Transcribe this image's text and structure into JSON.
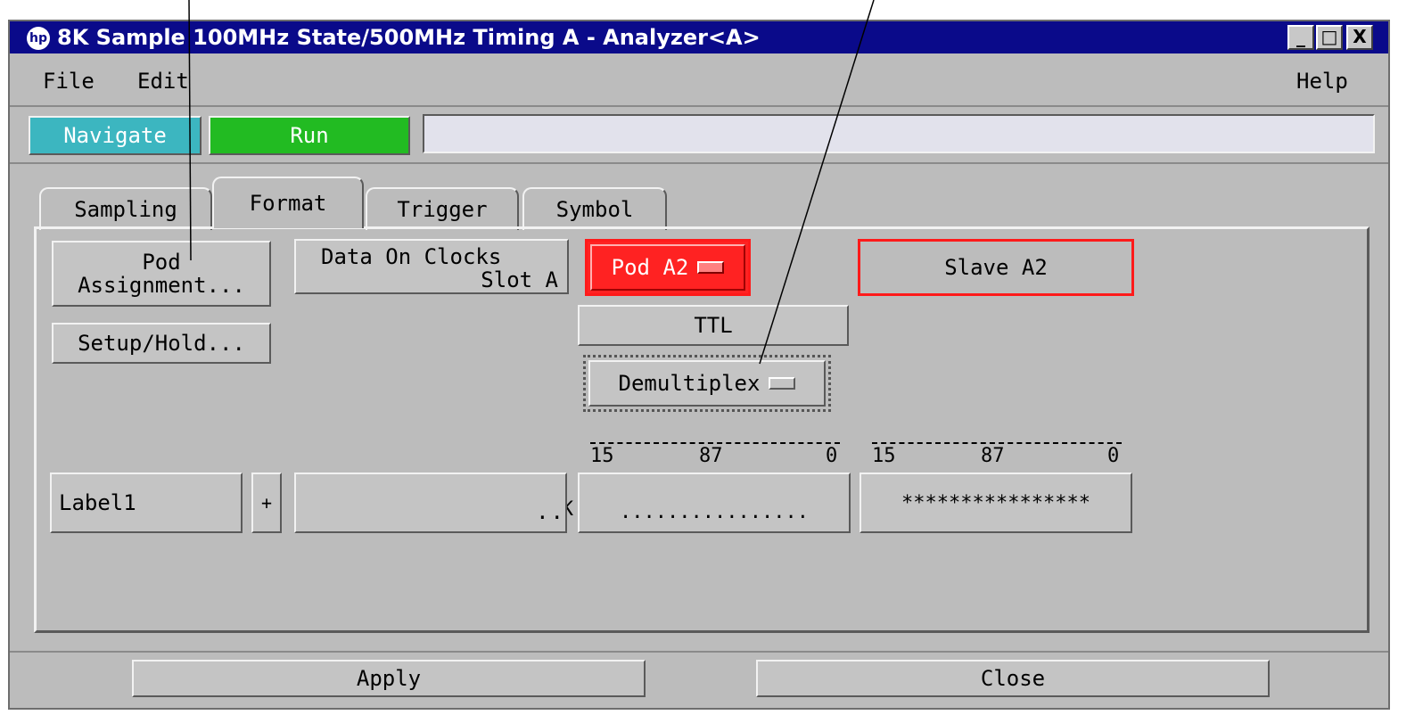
{
  "window": {
    "title": "8K Sample 100MHz State/500MHz Timing A - Analyzer<A>",
    "logo": "hp",
    "controls": {
      "minimize": "_",
      "maximize": "□",
      "close": "X"
    }
  },
  "menubar": {
    "file": "File",
    "edit": "Edit",
    "help": "Help"
  },
  "toolbar": {
    "navigate": "Navigate",
    "run": "Run",
    "status": ""
  },
  "tabs": [
    {
      "label": "Sampling",
      "active": false
    },
    {
      "label": "Format",
      "active": true
    },
    {
      "label": "Trigger",
      "active": false
    },
    {
      "label": "Symbol",
      "active": false
    }
  ],
  "format": {
    "pod_assignment": "Pod\nAssignment...",
    "setup_hold": "Setup/Hold...",
    "data_on_clocks_line1": "Data On Clocks",
    "data_on_clocks_line2": "Slot A",
    "pod_select": "Pod A2",
    "slave": "Slave A2",
    "threshold": "TTL",
    "mode": "Demultiplex"
  },
  "headers": {
    "clock_bits": "K̄K̄",
    "pod_a2": {
      "hi": "15",
      "mid": "87",
      "lo": "0"
    },
    "slave_a2": {
      "hi": "15",
      "mid": "87",
      "lo": "0"
    }
  },
  "label_row": {
    "label": "Label1",
    "polarity": "+",
    "clock_assign": "..",
    "pod_bits": "................",
    "slave_bits": "****************"
  },
  "footer": {
    "apply": "Apply",
    "close": "Close"
  }
}
